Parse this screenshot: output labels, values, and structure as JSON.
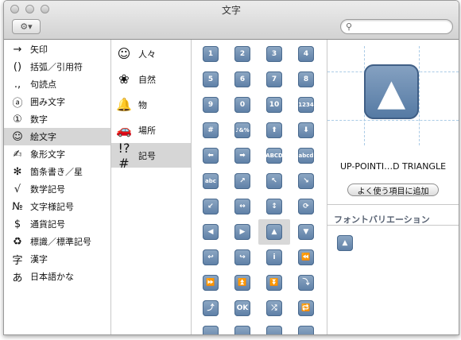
{
  "window": {
    "title": "文字"
  },
  "toolbar": {
    "gear_label": "⚙▾",
    "search_placeholder": ""
  },
  "categories": [
    {
      "icon": "→",
      "label": "矢印"
    },
    {
      "icon": "()",
      "label": "括弧／引用符"
    },
    {
      "icon": ".,",
      "label": "句読点"
    },
    {
      "icon": "ⓐ",
      "label": "囲み文字"
    },
    {
      "icon": "①",
      "label": "数字"
    },
    {
      "icon": "☺",
      "label": "絵文字",
      "selected": true
    },
    {
      "icon": "✍",
      "label": "象形文字"
    },
    {
      "icon": "✻",
      "label": "箇条書き／星"
    },
    {
      "icon": "√",
      "label": "数学記号"
    },
    {
      "icon": "№",
      "label": "文字様記号"
    },
    {
      "icon": "$",
      "label": "通貨記号"
    },
    {
      "icon": "♻",
      "label": "標識／標準記号"
    },
    {
      "icon": "字",
      "label": "漢字"
    },
    {
      "icon": "あ",
      "label": "日本語かな"
    }
  ],
  "subcategories": [
    {
      "icon": "☺",
      "label": "人々"
    },
    {
      "icon": "❀",
      "label": "自然"
    },
    {
      "icon": "🔔",
      "label": "物"
    },
    {
      "icon": "🚗",
      "label": "場所"
    },
    {
      "icon": "!?#",
      "label": "記号",
      "selected": true
    }
  ],
  "emoji_grid": [
    [
      "1",
      "2",
      "3",
      "4"
    ],
    [
      "5",
      "6",
      "7",
      "8"
    ],
    [
      "9",
      "0",
      "10",
      "1234"
    ],
    [
      "#",
      "♪&%",
      "⬆",
      "⬇"
    ],
    [
      "⬅",
      "➡",
      "ABCD",
      "abcd"
    ],
    [
      "abc",
      "↗",
      "↖",
      "↘"
    ],
    [
      "↙",
      "↔",
      "↕",
      "⟳"
    ],
    [
      "◀",
      "▶",
      "▲",
      "▼"
    ],
    [
      "↩",
      "↪",
      "i",
      "⏪"
    ],
    [
      "⏩",
      "⏫",
      "⏬",
      "⤵"
    ],
    [
      "⤴",
      "OK",
      "⤮",
      "🔁"
    ],
    [
      "",
      "",
      "",
      ""
    ]
  ],
  "selected_char": {
    "glyph": "▲",
    "name": "UP-POINTI…D TRIANGLE"
  },
  "fav_button": "よく使う項目に追加",
  "font_variation": {
    "label": "フォントバリエーション",
    "glyph": "▲"
  }
}
